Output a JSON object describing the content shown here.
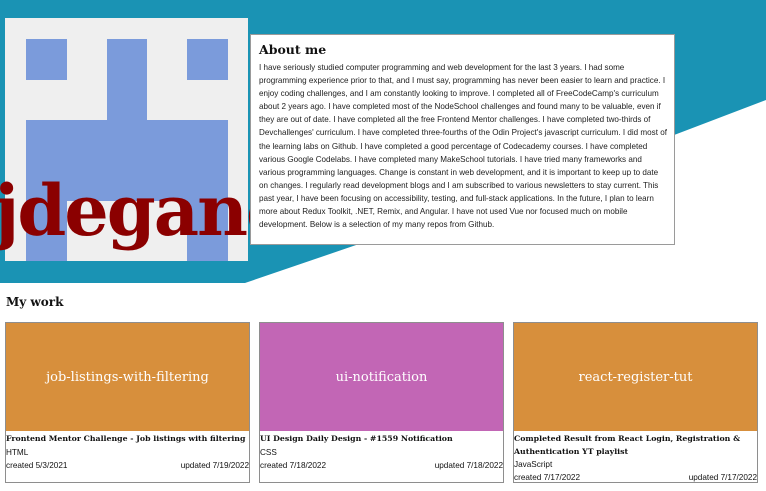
{
  "colors": {
    "hero_teal": "#1a93b4",
    "logo_blue": "#7b9bdb",
    "logo_text": "#8b0000",
    "html_banner": "#d78f3c",
    "css_banner": "#c266b5",
    "js_banner": "#d78f3c"
  },
  "logo": {
    "text": "jdegand"
  },
  "about": {
    "title": "About me",
    "body": "I have seriously studied computer programming and web development for the last 3 years. I had some programming experience prior to that, and I must say, programming has never been easier to learn and practice. I enjoy coding challenges, and I am constantly looking to improve. I completed all of FreeCodeCamp's curriculum about 2 years ago. I have completed most of the NodeSchool challenges and found many to be valuable, even if they are out of date. I have completed all the free Frontend Mentor challenges. I have completed two-thirds of Devchallenges' curriculum. I have completed three-fourths of the Odin Project's javascript curriculum. I did most of the learning labs on Github. I have completed a good percentage of Codecademy courses. I have completed various Google Codelabs. I have completed many MakeSchool tutorials. I have tried many frameworks and various programming languages. Change is constant in web development, and it is important to keep up to date on changes. I regularly read development blogs and I am subscribed to various newsletters to stay current. This past year, I have been focusing on accessibility, testing, and full-stack applications. In the future, I plan to learn more about Redux Toolkit, .NET, Remix, and Angular. I have not used Vue nor focused much on mobile development. Below is a selection of my many repos from Github."
  },
  "work": {
    "title": "My work",
    "repos": [
      {
        "name": "job-listings-with-filtering",
        "description": "Frontend Mentor Challenge - Job listings with filtering",
        "language": "HTML",
        "created": "created 5/3/2021",
        "updated": "updated 7/19/2022"
      },
      {
        "name": "ui-notification",
        "description": "UI Design Daily Design - #1559 Notification",
        "language": "CSS",
        "created": "created 7/18/2022",
        "updated": "updated 7/18/2022"
      },
      {
        "name": "react-register-tut",
        "description": "Completed Result from React Login, Registration & Authentication YT playlist",
        "language": "JavaScript",
        "created": "created 7/17/2022",
        "updated": "updated 7/17/2022"
      }
    ]
  }
}
